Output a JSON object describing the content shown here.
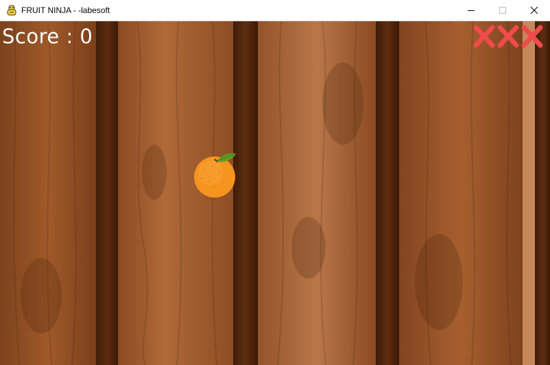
{
  "window": {
    "title": "FRUIT NINJA - -labesoft",
    "app_icon": "python-snake-icon",
    "controls": [
      "minimize-icon",
      "maximize-icon",
      "close-icon"
    ]
  },
  "hud": {
    "score_text": "Score : 0",
    "lives_lost_marks": 3,
    "lives_mark_color": "#ee4b4b"
  },
  "scene": {
    "background": "wooden-planks",
    "fruits": [
      {
        "kind": "orange",
        "color": "#f5941f",
        "leaf_color": "#5a9e2a"
      }
    ]
  }
}
